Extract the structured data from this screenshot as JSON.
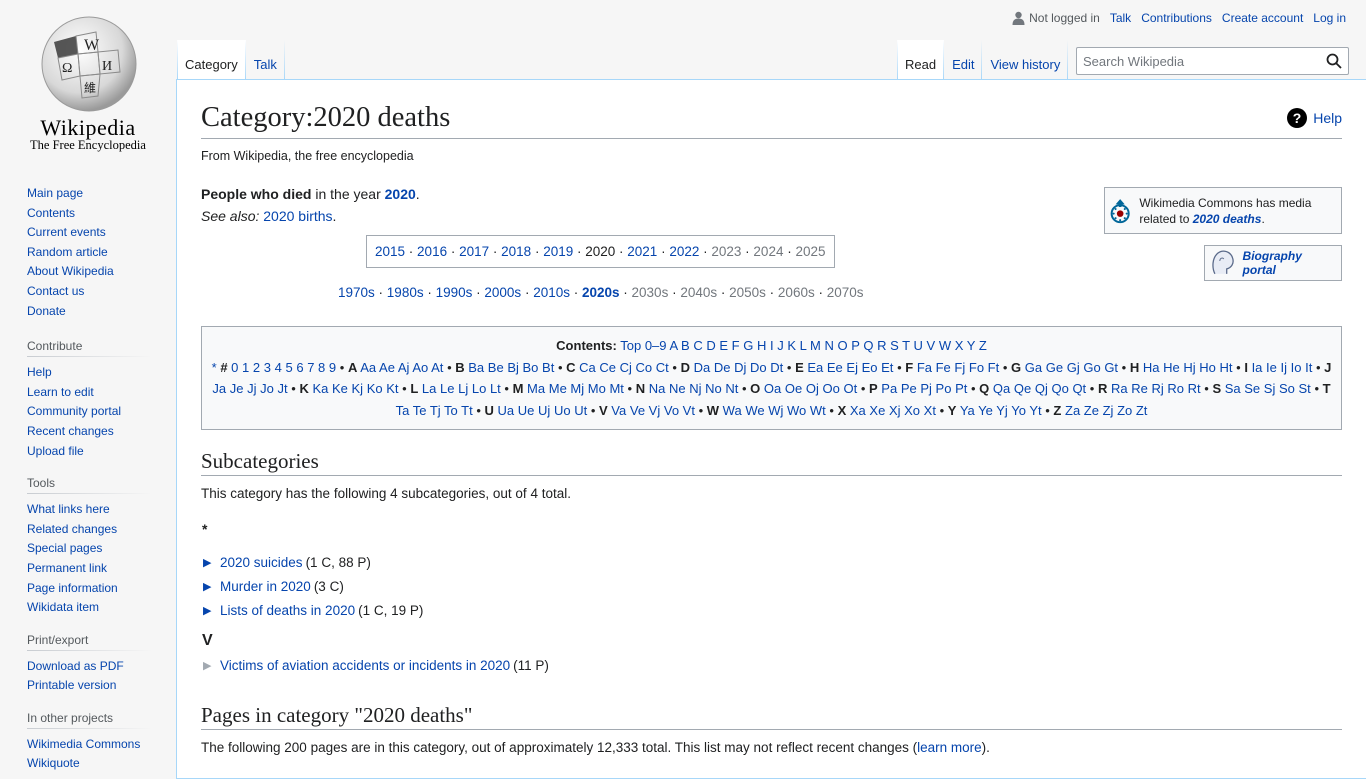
{
  "logo": {
    "wordmark": "Wikipedia",
    "tagline": "The Free Encyclopedia"
  },
  "personal": {
    "not_logged_in": "Not logged in",
    "talk": "Talk",
    "contributions": "Contributions",
    "create_account": "Create account",
    "log_in": "Log in"
  },
  "tabs": {
    "category": "Category",
    "talk": "Talk",
    "read": "Read",
    "edit": "Edit",
    "view_history": "View history"
  },
  "search": {
    "placeholder": "Search Wikipedia"
  },
  "sidebar": {
    "navigation": [
      "Main page",
      "Contents",
      "Current events",
      "Random article",
      "About Wikipedia",
      "Contact us",
      "Donate"
    ],
    "contribute": {
      "heading": "Contribute",
      "items": [
        "Help",
        "Learn to edit",
        "Community portal",
        "Recent changes",
        "Upload file"
      ]
    },
    "tools": {
      "heading": "Tools",
      "items": [
        "What links here",
        "Related changes",
        "Special pages",
        "Permanent link",
        "Page information",
        "Wikidata item"
      ]
    },
    "print": {
      "heading": "Print/export",
      "items": [
        "Download as PDF",
        "Printable version"
      ]
    },
    "other": {
      "heading": "In other projects",
      "items": [
        "Wikimedia Commons",
        "Wikiquote"
      ]
    }
  },
  "page": {
    "title": "Category:2020 deaths",
    "help": "Help",
    "site_sub": "From Wikipedia, the free encyclopedia",
    "intro_bold": "People who died",
    "intro_mid": " in the year ",
    "intro_year": "2020",
    "intro_end": ".",
    "see_also_label": "See also:",
    "see_also_link": "2020 births",
    "see_also_end": "."
  },
  "years": [
    {
      "label": "2015",
      "state": "link"
    },
    {
      "label": "2016",
      "state": "link"
    },
    {
      "label": "2017",
      "state": "link"
    },
    {
      "label": "2018",
      "state": "link"
    },
    {
      "label": "2019",
      "state": "link"
    },
    {
      "label": "2020",
      "state": "current"
    },
    {
      "label": "2021",
      "state": "link"
    },
    {
      "label": "2022",
      "state": "link"
    },
    {
      "label": "2023",
      "state": "gray"
    },
    {
      "label": "2024",
      "state": "gray"
    },
    {
      "label": "2025",
      "state": "gray"
    }
  ],
  "decades": [
    {
      "label": "1970s",
      "state": "link"
    },
    {
      "label": "1980s",
      "state": "link"
    },
    {
      "label": "1990s",
      "state": "link"
    },
    {
      "label": "2000s",
      "state": "link"
    },
    {
      "label": "2010s",
      "state": "link"
    },
    {
      "label": "2020s",
      "state": "bold"
    },
    {
      "label": "2030s",
      "state": "gray"
    },
    {
      "label": "2040s",
      "state": "gray"
    },
    {
      "label": "2050s",
      "state": "gray"
    },
    {
      "label": "2060s",
      "state": "gray"
    },
    {
      "label": "2070s",
      "state": "gray"
    }
  ],
  "commons": {
    "text": "Wikimedia Commons has media related to ",
    "link": "2020 deaths",
    "end": "."
  },
  "portal": {
    "label": "Biography portal"
  },
  "toc": {
    "label": "Contents:",
    "top_links": [
      "Top",
      "0–9",
      "A",
      "B",
      "C",
      "D",
      "E",
      "F",
      "G",
      "H",
      "I",
      "J",
      "K",
      "L",
      "M",
      "N",
      "O",
      "P",
      "Q",
      "R",
      "S",
      "T",
      "U",
      "V",
      "W",
      "X",
      "Y",
      "Z"
    ],
    "prefix": [
      "*",
      "#",
      "0",
      "1",
      "2",
      "3",
      "4",
      "5",
      "6",
      "7",
      "8",
      "9"
    ],
    "letters": [
      {
        "l": "A",
        "s": [
          "Aa",
          "Ae",
          "Aj",
          "Ao",
          "At"
        ]
      },
      {
        "l": "B",
        "s": [
          "Ba",
          "Be",
          "Bj",
          "Bo",
          "Bt"
        ]
      },
      {
        "l": "C",
        "s": [
          "Ca",
          "Ce",
          "Cj",
          "Co",
          "Ct"
        ]
      },
      {
        "l": "D",
        "s": [
          "Da",
          "De",
          "Dj",
          "Do",
          "Dt"
        ]
      },
      {
        "l": "E",
        "s": [
          "Ea",
          "Ee",
          "Ej",
          "Eo",
          "Et"
        ]
      },
      {
        "l": "F",
        "s": [
          "Fa",
          "Fe",
          "Fj",
          "Fo",
          "Ft"
        ]
      },
      {
        "l": "G",
        "s": [
          "Ga",
          "Ge",
          "Gj",
          "Go",
          "Gt"
        ]
      },
      {
        "l": "H",
        "s": [
          "Ha",
          "He",
          "Hj",
          "Ho",
          "Ht"
        ]
      },
      {
        "l": "I",
        "s": [
          "Ia",
          "Ie",
          "Ij",
          "Io",
          "It"
        ]
      },
      {
        "l": "J",
        "s": [
          "Ja",
          "Je",
          "Jj",
          "Jo",
          "Jt"
        ]
      },
      {
        "l": "K",
        "s": [
          "Ka",
          "Ke",
          "Kj",
          "Ko",
          "Kt"
        ]
      },
      {
        "l": "L",
        "s": [
          "La",
          "Le",
          "Lj",
          "Lo",
          "Lt"
        ]
      },
      {
        "l": "M",
        "s": [
          "Ma",
          "Me",
          "Mj",
          "Mo",
          "Mt"
        ]
      },
      {
        "l": "N",
        "s": [
          "Na",
          "Ne",
          "Nj",
          "No",
          "Nt"
        ]
      },
      {
        "l": "O",
        "s": [
          "Oa",
          "Oe",
          "Oj",
          "Oo",
          "Ot"
        ]
      },
      {
        "l": "P",
        "s": [
          "Pa",
          "Pe",
          "Pj",
          "Po",
          "Pt"
        ]
      },
      {
        "l": "Q",
        "s": [
          "Qa",
          "Qe",
          "Qj",
          "Qo",
          "Qt"
        ]
      },
      {
        "l": "R",
        "s": [
          "Ra",
          "Re",
          "Rj",
          "Ro",
          "Rt"
        ]
      },
      {
        "l": "S",
        "s": [
          "Sa",
          "Se",
          "Sj",
          "So",
          "St"
        ]
      },
      {
        "l": "T",
        "s": [
          "Ta",
          "Te",
          "Tj",
          "To",
          "Tt"
        ]
      },
      {
        "l": "U",
        "s": [
          "Ua",
          "Ue",
          "Uj",
          "Uo",
          "Ut"
        ]
      },
      {
        "l": "V",
        "s": [
          "Va",
          "Ve",
          "Vj",
          "Vo",
          "Vt"
        ]
      },
      {
        "l": "W",
        "s": [
          "Wa",
          "We",
          "Wj",
          "Wo",
          "Wt"
        ]
      },
      {
        "l": "X",
        "s": [
          "Xa",
          "Xe",
          "Xj",
          "Xo",
          "Xt"
        ]
      },
      {
        "l": "Y",
        "s": [
          "Ya",
          "Ye",
          "Yj",
          "Yo",
          "Yt"
        ]
      },
      {
        "l": "Z",
        "s": [
          "Za",
          "Ze",
          "Zj",
          "Zo",
          "Zt"
        ]
      }
    ]
  },
  "subcategories": {
    "heading": "Subcategories",
    "desc": "This category has the following 4 subcategories, out of 4 total.",
    "group1": "*",
    "items": [
      {
        "name": "2020 suicides",
        "count": "(1 C, 88 P)"
      },
      {
        "name": "Murder in 2020",
        "count": "(3 C)"
      },
      {
        "name": "Lists of deaths in 2020",
        "count": "(1 C, 19 P)"
      }
    ],
    "group2": "V",
    "items2": [
      {
        "name": "Victims of aviation accidents or incidents in 2020",
        "count": "(11 P)"
      }
    ]
  },
  "pages": {
    "heading": "Pages in category \"2020 deaths\"",
    "desc": "The following 200 pages are in this category, out of approximately 12,333 total. This list may not reflect recent changes (",
    "link": "learn more",
    "end": ")."
  },
  "colors": {
    "link": "#0645ad",
    "border": "#a2a9b1",
    "tab_border": "#a7d7f9"
  }
}
